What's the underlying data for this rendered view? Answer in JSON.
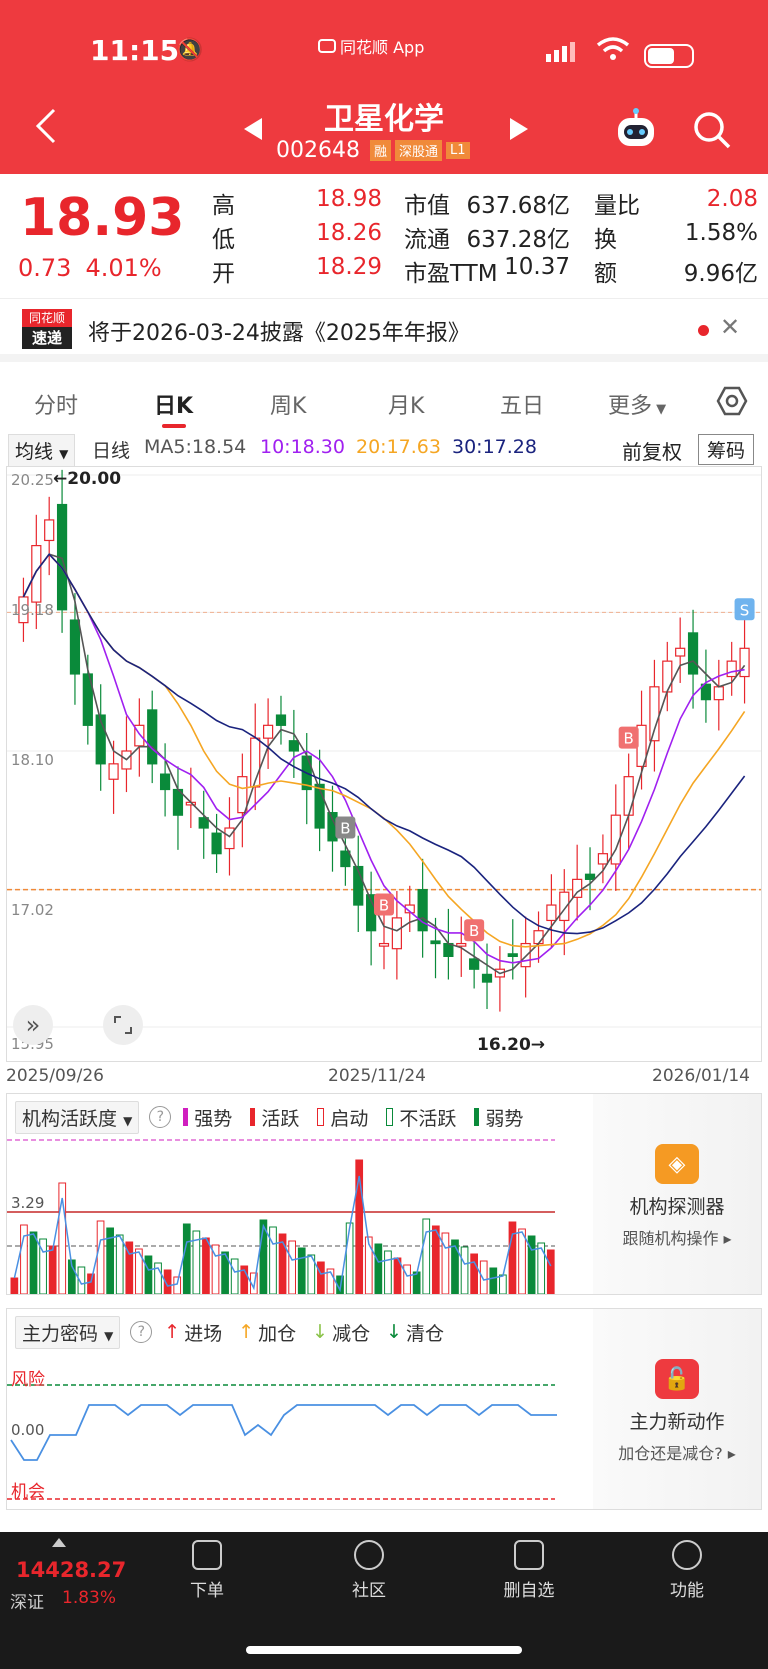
{
  "status": {
    "time": "11:15",
    "app_label": "同花顺 App"
  },
  "nav": {
    "title": "卫星化学",
    "code": "002648",
    "badges": [
      "融",
      "深股通",
      "L1"
    ]
  },
  "quote": {
    "price": "18.93",
    "change": "0.73",
    "change_pct": "4.01%",
    "fields": [
      {
        "label": "高",
        "value": "18.98",
        "red": true
      },
      {
        "label": "低",
        "value": "18.26",
        "red": true
      },
      {
        "label": "开",
        "value": "18.29",
        "red": true
      }
    ],
    "fields2": [
      {
        "label": "市值",
        "value": "637.68亿"
      },
      {
        "label": "流通",
        "value": "637.28亿"
      },
      {
        "label": "市盈TTM",
        "value": "10.37"
      }
    ],
    "fields3": [
      {
        "label": "量比",
        "value": "2.08",
        "red": true
      },
      {
        "label": "换",
        "value": "1.58%"
      },
      {
        "label": "额",
        "value": "9.96亿"
      }
    ]
  },
  "notice": {
    "logo_top": "同花顺",
    "logo_bottom": "速递",
    "text": "将于2026-03-24披露《2025年年报》"
  },
  "tabs": [
    {
      "label": "分时",
      "active": false
    },
    {
      "label": "日K",
      "active": true
    },
    {
      "label": "周K",
      "active": false
    },
    {
      "label": "月K",
      "active": false
    },
    {
      "label": "五日",
      "active": false
    },
    {
      "label": "更多",
      "active": false
    }
  ],
  "ma": {
    "selector": "均线",
    "period": "日线",
    "ma5": "MA5:18.54",
    "ma10": "10:18.30",
    "ma20": "20:17.63",
    "ma30": "30:17.28",
    "adjust": "前复权",
    "chip": "筹码",
    "colors": {
      "ma5": "#555555",
      "ma10": "#a020f0",
      "ma20": "#f5a623",
      "ma30": "#1a237e"
    }
  },
  "chart_data": {
    "type": "candlestick",
    "y_ticks": [
      "20.25",
      "19.18",
      "18.10",
      "17.02",
      "15.95"
    ],
    "ylim": [
      15.95,
      20.25
    ],
    "max_label": "←20.00",
    "min_label": "16.20→",
    "x_dates": [
      "2025/09/26",
      "2025/11/24",
      "2026/01/14"
    ],
    "signals": [
      {
        "label": "B",
        "index": 25
      },
      {
        "label": "B",
        "index": 28
      },
      {
        "label": "B",
        "index": 35
      },
      {
        "label": "B",
        "index": 47
      },
      {
        "label": "S",
        "index": 64
      }
    ],
    "ref_line": 19.18,
    "dotted_line": 17.02
  },
  "panel1": {
    "selector": "机构活跃度",
    "legend": [
      {
        "label": "强势",
        "color": "#d01fbf"
      },
      {
        "label": "活跃",
        "color": "#e8262c"
      },
      {
        "label": "启动",
        "color": "#e8262c"
      },
      {
        "label": "不活跃",
        "color": "#0a8a3a"
      },
      {
        "label": "弱势",
        "color": "#0a8a3a"
      }
    ],
    "value_label": "3.29",
    "side_title": "机构探测器",
    "side_sub": "跟随机构操作 ▸"
  },
  "panel2": {
    "selector": "主力密码",
    "legend": [
      {
        "label": "进场",
        "color": "#e8262c"
      },
      {
        "label": "加仓",
        "color": "#f5a623"
      },
      {
        "label": "减仓",
        "color": "#8bc34a"
      },
      {
        "label": "清仓",
        "color": "#0a8a3a"
      }
    ],
    "risk": "风险",
    "zero": "0.00",
    "chance": "机会",
    "side_title": "主力新动作",
    "side_sub": "加仓还是减仓? ▸"
  },
  "bottom": {
    "index_value": "14428.27",
    "index_name": "深证",
    "index_pct": "1.83%",
    "items": [
      "下单",
      "社区",
      "删自选",
      "功能"
    ]
  }
}
